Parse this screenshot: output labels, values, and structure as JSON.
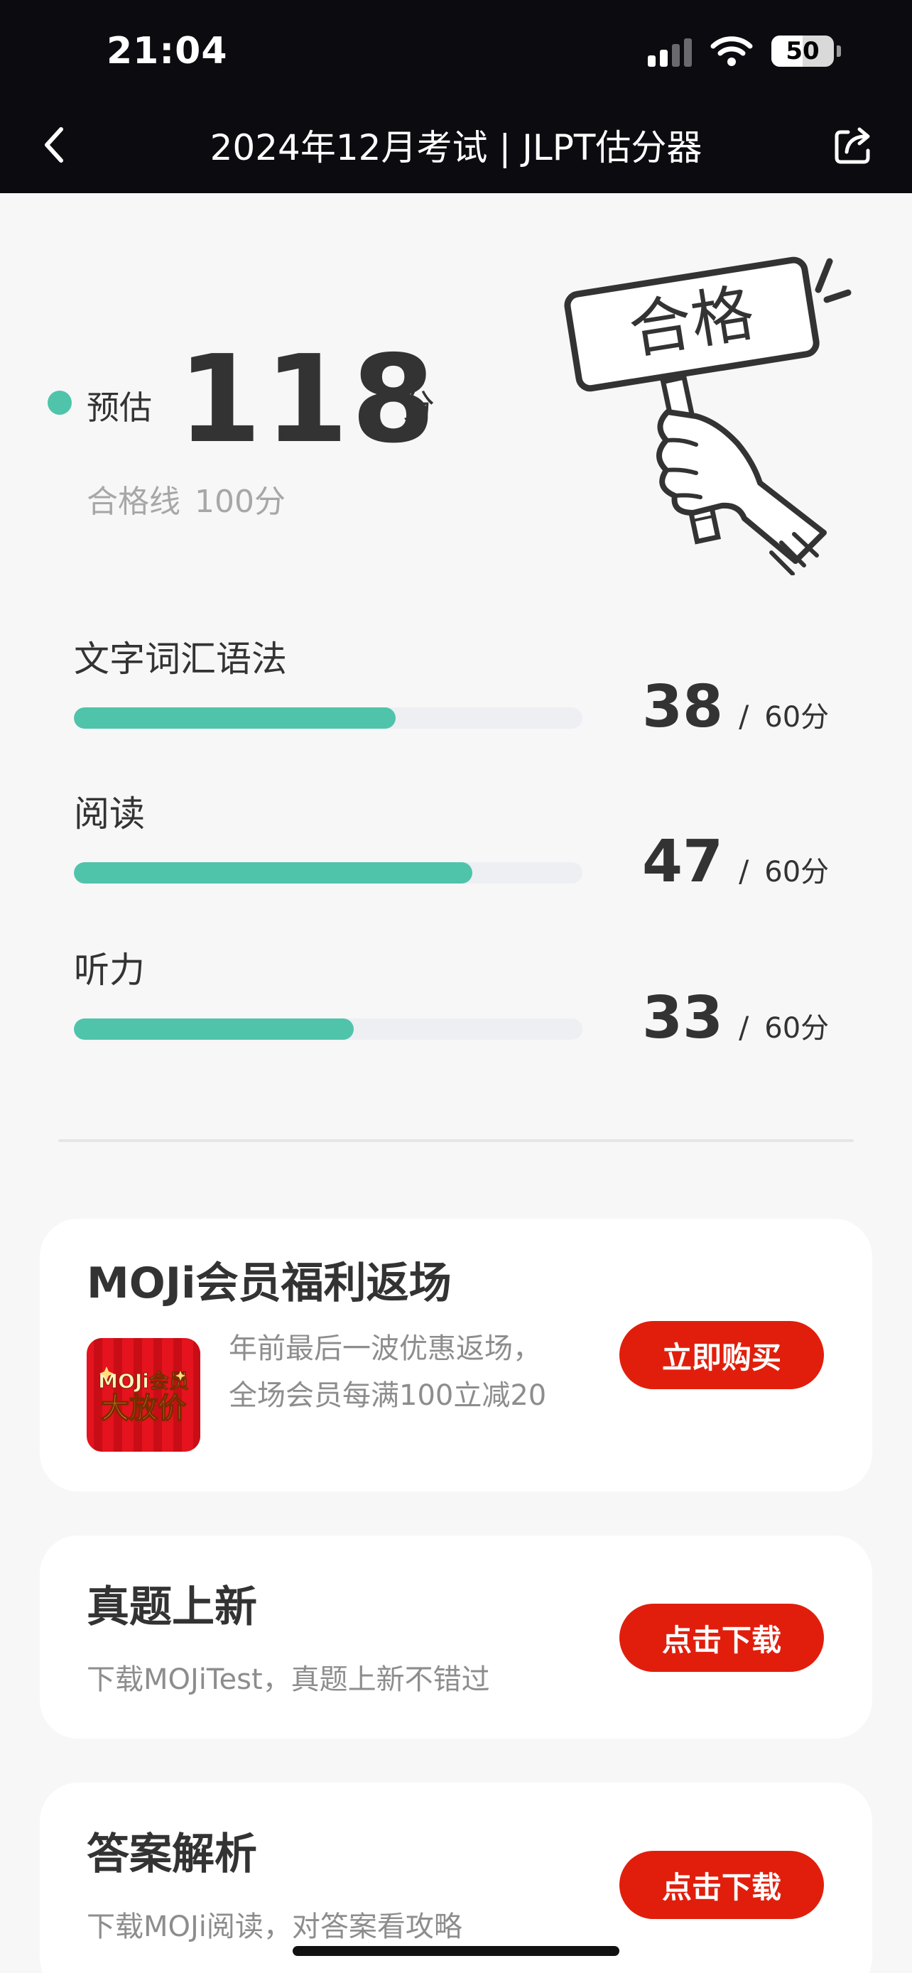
{
  "status_bar": {
    "time": "21:04",
    "battery": "50"
  },
  "nav": {
    "title": "2024年12月考试 | JLPT估分器"
  },
  "score": {
    "prefix": "预估",
    "value": "118",
    "unit": "分",
    "passline_label": "合格线",
    "passline_value": "100分",
    "stamp_text": "合格"
  },
  "sections": [
    {
      "label": "文字词汇语法",
      "score": "38",
      "max": "60分",
      "progress": 0.633
    },
    {
      "label": "阅读",
      "score": "47",
      "max": "60分",
      "progress": 0.783
    },
    {
      "label": "听力",
      "score": "33",
      "max": "60分",
      "progress": 0.55
    }
  ],
  "separator": "/",
  "cards": {
    "promo": {
      "title": "MOJi会员福利返场",
      "image_line1": "MOJi会员",
      "image_line2": "大放价",
      "description": "年前最后一波优惠返场，全场会员每满100立减20",
      "button": "立即购买"
    },
    "exam": {
      "title": "真题上新",
      "description": "下载MOJiTest，真题上新不错过",
      "button": "点击下载"
    },
    "answer": {
      "title": "答案解析",
      "description": "下载MOJi阅读，对答案看攻略",
      "button": "点击下载"
    }
  },
  "colors": {
    "accent": "#4fc4aa",
    "button": "#e11e0c",
    "header": "#0b0b10"
  },
  "icons": [
    "back-icon",
    "share-icon",
    "signal-icon",
    "wifi-icon",
    "battery-icon",
    "pass-stamp-icon"
  ]
}
